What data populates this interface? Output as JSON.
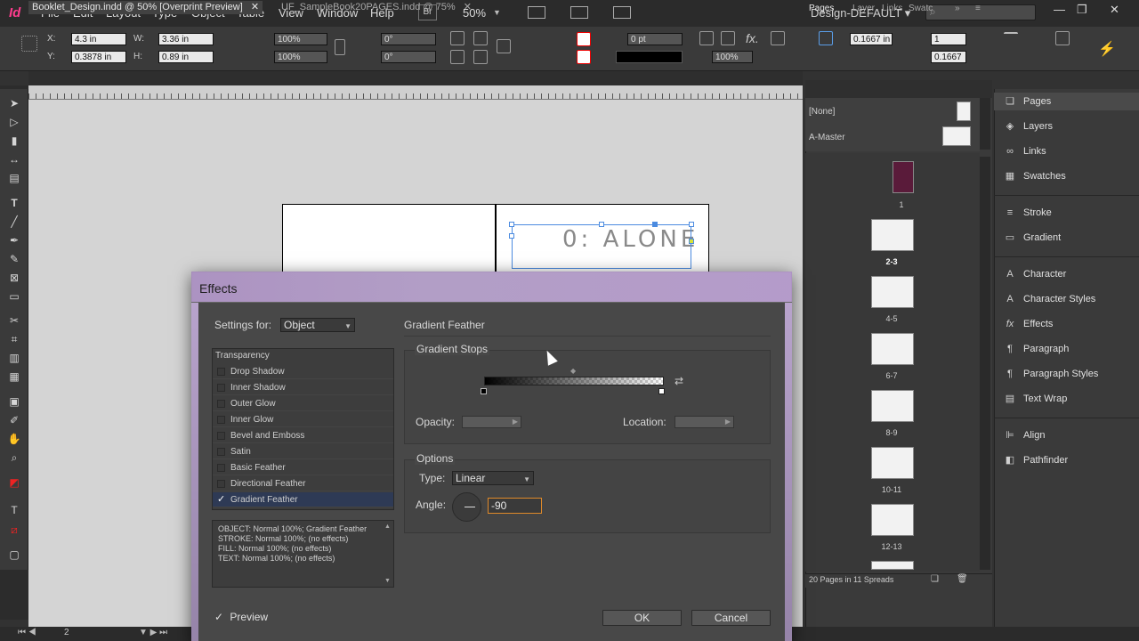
{
  "menubar": {
    "logo": "Id",
    "items": [
      "File",
      "Edit",
      "Layout",
      "Type",
      "Object",
      "Table",
      "View",
      "Window",
      "Help"
    ],
    "bridge": "Br",
    "zoom": "50%",
    "workspace": "Design-DEFAULT ▾"
  },
  "control": {
    "x_label": "X:",
    "x": "4.3 in",
    "y_label": "Y:",
    "y": "0.3878 in",
    "w_label": "W:",
    "w": "3.36 in",
    "h_label": "H:",
    "h": "0.89 in",
    "scale_x": "100%",
    "scale_y": "100%",
    "rotate": "0°",
    "shear": "0°",
    "stroke_weight": "0 pt",
    "opacity": "100%",
    "offset_a": "0.1667 in",
    "offset_b": "0.1667",
    "columns": "1"
  },
  "tabs": {
    "active": "Booklet_Design.indd @ 50% [Overprint Preview]",
    "inactive": "UF_SampleBook20PAGES.indd @ 75%"
  },
  "canvas": {
    "headline": "0: ALONE"
  },
  "pages_panel": {
    "tabs": [
      "Pages",
      "Layer",
      "Links",
      "Swatc"
    ],
    "masters": [
      "[None]",
      "A-Master"
    ],
    "page_labels": [
      "1",
      "2-3",
      "4-5",
      "6-7",
      "8-9",
      "10-11",
      "12-13"
    ],
    "summary": "20 Pages in 11 Spreads"
  },
  "status": {
    "page": "2"
  },
  "dock": {
    "items": [
      {
        "label": "Pages",
        "icon": "❏"
      },
      {
        "label": "Layers",
        "icon": "◈"
      },
      {
        "label": "Links",
        "icon": "∞"
      },
      {
        "label": "Swatches",
        "icon": "▦"
      },
      {
        "label": "Stroke",
        "icon": "≡"
      },
      {
        "label": "Gradient",
        "icon": "▭"
      },
      {
        "label": "Character",
        "icon": "A"
      },
      {
        "label": "Character Styles",
        "icon": "A"
      },
      {
        "label": "Effects",
        "icon": "fx"
      },
      {
        "label": "Paragraph",
        "icon": "¶"
      },
      {
        "label": "Paragraph Styles",
        "icon": "¶"
      },
      {
        "label": "Text Wrap",
        "icon": "▤"
      },
      {
        "label": "Align",
        "icon": "⊫"
      },
      {
        "label": "Pathfinder",
        "icon": "◧"
      }
    ]
  },
  "dialog": {
    "title": "Effects",
    "settings_for_label": "Settings for:",
    "settings_for_value": "Object",
    "section_title": "Gradient Feather",
    "list_header": "Transparency",
    "effects": [
      {
        "label": "Drop Shadow",
        "checked": false
      },
      {
        "label": "Inner Shadow",
        "checked": false
      },
      {
        "label": "Outer Glow",
        "checked": false
      },
      {
        "label": "Inner Glow",
        "checked": false
      },
      {
        "label": "Bevel and Emboss",
        "checked": false
      },
      {
        "label": "Satin",
        "checked": false
      },
      {
        "label": "Basic Feather",
        "checked": false
      },
      {
        "label": "Directional Feather",
        "checked": false
      },
      {
        "label": "Gradient Feather",
        "checked": true
      }
    ],
    "summary": [
      "OBJECT: Normal 100%; Gradient Feather",
      "STROKE: Normal 100%; (no effects)",
      "FILL: Normal 100%; (no effects)",
      "TEXT: Normal 100%; (no effects)"
    ],
    "gradient_stops_label": "Gradient Stops",
    "opacity_label": "Opacity:",
    "location_label": "Location:",
    "options_label": "Options",
    "type_label": "Type:",
    "type_value": "Linear",
    "angle_label": "Angle:",
    "angle_value": "-90",
    "preview_label": "Preview",
    "ok_label": "OK",
    "cancel_label": "Cancel",
    "check_mark": "✓"
  }
}
